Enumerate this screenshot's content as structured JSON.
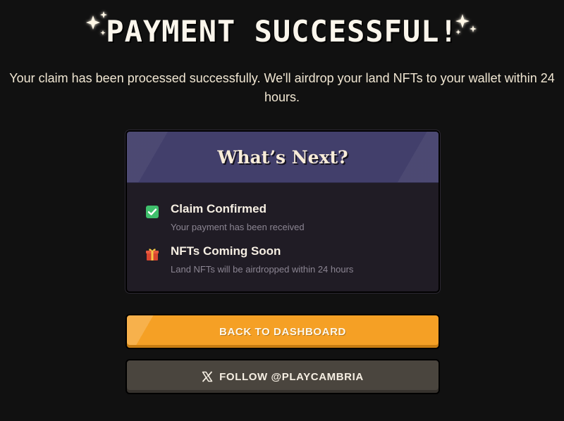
{
  "header": {
    "title": "PAYMENT SUCCESSFUL!",
    "sparkle_icon": "sparkle-icon",
    "subtitle": "Your claim has been processed successfully. We'll airdrop your land NFTs to your wallet within 24 hours."
  },
  "card": {
    "title": "What’s Next?",
    "steps": [
      {
        "icon": "check-icon",
        "title": "Claim Confirmed",
        "description": "Your payment has been received"
      },
      {
        "icon": "gift-icon",
        "title": "NFTs Coming Soon",
        "description": "Land NFTs will be airdropped within 24 hours"
      }
    ]
  },
  "buttons": {
    "dashboard_label": "BACK TO DASHBOARD",
    "follow_label": "FOLLOW @PLAYCAMBRIA",
    "follow_icon": "x-logo-icon"
  },
  "colors": {
    "background": "#111111",
    "card_header": "#423f6b",
    "card_body": "#201c25",
    "primary_button": "#f5a025",
    "secondary_button": "#4a453e",
    "check_green": "#3fbf6c"
  }
}
